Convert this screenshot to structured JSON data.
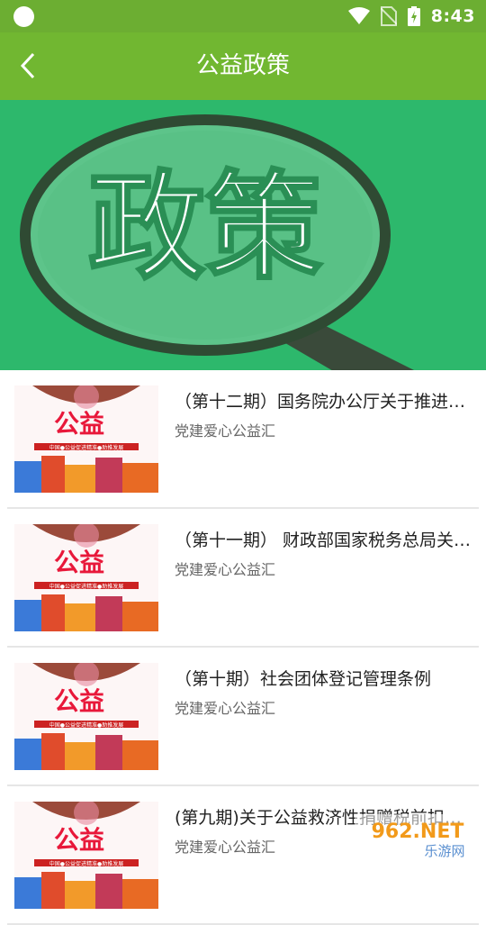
{
  "status": {
    "time": "8:43"
  },
  "header": {
    "title": "公益政策"
  },
  "banner": {
    "text": "政策"
  },
  "thumb_text": {
    "main": "公益",
    "sub": "中国●公益促进精准●助推发展"
  },
  "items": [
    {
      "title": "（第十二期）国务院办公厅关于推进养老服务发展的意见",
      "source": "党建爱心公益汇"
    },
    {
      "title": "（第十一期） 财政部国家税务总局关于公益性捐赠税前扣除",
      "source": "党建爱心公益汇"
    },
    {
      "title": "（第十期）社会团体登记管理条例",
      "source": "党建爱心公益汇"
    },
    {
      "title": "(第九期)关于公益救济性捐赠税前扣除政策",
      "source": "党建爱心公益汇"
    }
  ],
  "watermark": {
    "top": "962.NET",
    "bottom": "乐游网"
  },
  "colors": {
    "header": "#71b731",
    "banner": "#2db86c"
  }
}
